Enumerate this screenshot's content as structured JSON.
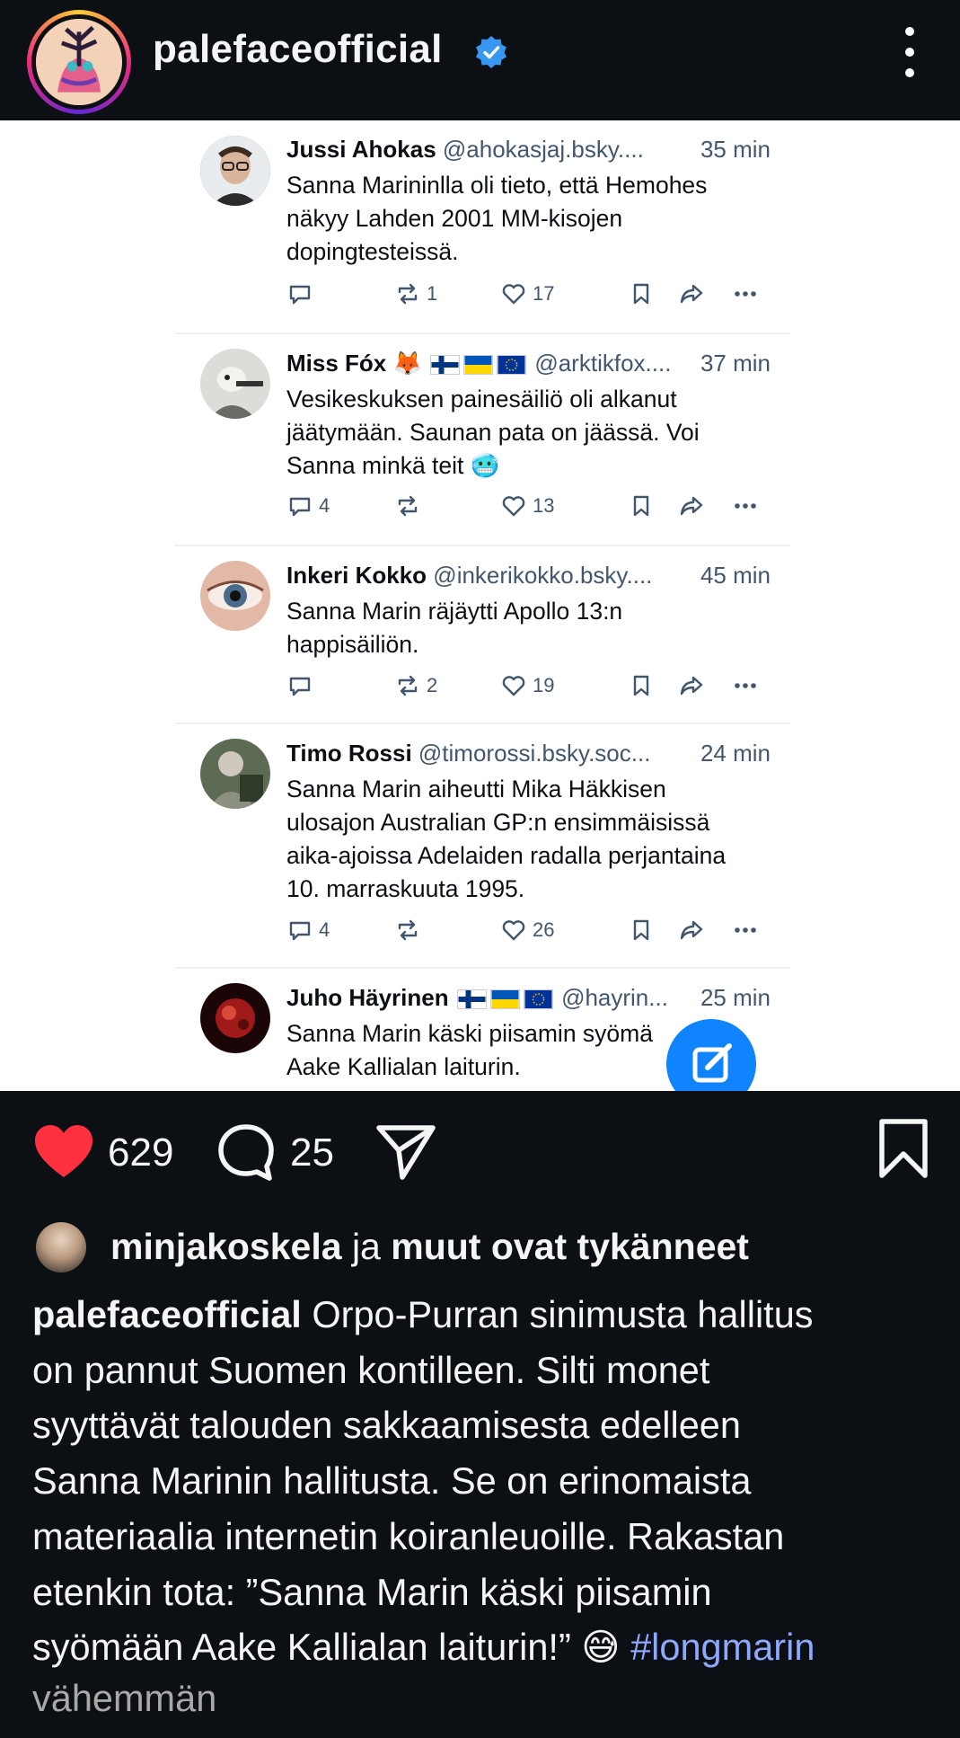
{
  "header": {
    "username": "palefaceofficial",
    "verified_icon": "verified-badge-icon",
    "more_icon": "more-vertical-icon"
  },
  "embedded": {
    "posts": [
      {
        "name": "Jussi Ahokas",
        "handle": "@ahokasjaj.bsky....",
        "time": "35 min",
        "lines": [
          "Sanna Marininlla oli tieto, että Hemohes",
          "näkyy Lahden 2001 MM-kisojen",
          "dopingtesteissä."
        ],
        "replies": "",
        "reposts": "1",
        "likes": "17"
      },
      {
        "name": "Miss Fóx 🦊",
        "handle": "@arktikfox....",
        "time": "37 min",
        "lines": [
          "Vesikeskuksen painesäiliö oli alkanut",
          "jäätymään. Saunan pata on jäässä. Voi",
          "Sanna minkä teit 🥶"
        ],
        "replies": "4",
        "reposts": "",
        "likes": "13"
      },
      {
        "name": "Inkeri Kokko",
        "handle": "@inkerikokko.bsky....",
        "time": "45 min",
        "lines": [
          "Sanna Marin räjäytti Apollo 13:n",
          "happisäiliön."
        ],
        "replies": "",
        "reposts": "2",
        "likes": "19"
      },
      {
        "name": "Timo Rossi",
        "handle": "@timorossi.bsky.soc...",
        "time": "24 min",
        "lines": [
          "Sanna Marin aiheutti Mika Häkkisen",
          "ulosajon Australian GP:n ensimmäisissä",
          "aika-ajoissa Adelaiden radalla perjantaina",
          "10. marraskuuta 1995."
        ],
        "replies": "4",
        "reposts": "",
        "likes": "26"
      },
      {
        "name": "Juho Häyrinen",
        "handle": "@hayrin...",
        "time": "25 min",
        "lines": [
          "Sanna Marin käski piisamin syömä",
          "Aake Kallialan laiturin."
        ]
      }
    ],
    "compose_icon": "compose-icon"
  },
  "actions": {
    "like_count": "629",
    "comment_count": "25",
    "icons": [
      "heart-icon",
      "comment-icon",
      "share-icon",
      "bookmark-icon"
    ]
  },
  "likes": {
    "user": "minjakoskela",
    "connector": "ja",
    "rest": "muut ovat tykänneet"
  },
  "caption": {
    "username": "palefaceofficial",
    "lines": [
      " Orpo-Purran sinimusta hallitus",
      "on pannut Suomen kontilleen. Silti monet",
      "syyttävät talouden sakkaamisesta edelleen",
      "Sanna Marinin hallitusta. Se on erinomaista",
      "materiaalia internetin koiranleuoille. Rakastan",
      "etenkin tota: ”Sanna Marin käski piisamin",
      "syömään Aake Kallialan laiturin!” 😅 "
    ],
    "hashtag": "#longmarin",
    "less_label": "vähemmän"
  },
  "colors": {
    "background": "#0c1014",
    "like_red": "#ff3040",
    "bluesky_blue": "#1083fe",
    "hashtag": "#8fa8ff"
  }
}
